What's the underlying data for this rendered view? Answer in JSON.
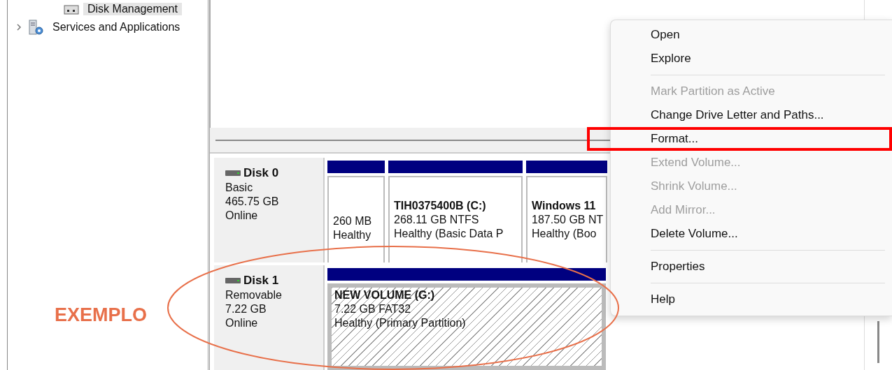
{
  "tree": [
    {
      "label": "Disk Management",
      "selected": true
    },
    {
      "label": "Services and Applications",
      "selected": false,
      "expanded": false
    }
  ],
  "disks": [
    {
      "name": "Disk 0",
      "type": "Basic",
      "size": "465.75 GB",
      "status": "Online",
      "partitions": [
        {
          "detail": "260 MB",
          "status": "Healthy",
          "selected": false
        },
        {
          "title": "TIH0375400B  (C:)",
          "detail": "268.11 GB NTFS",
          "status": "Healthy (Basic Data P",
          "selected": false
        },
        {
          "title": "Windows 11",
          "detail": "187.50 GB NT",
          "status": "Healthy (Boo",
          "selected": false
        }
      ]
    },
    {
      "name": "Disk 1",
      "type": "Removable",
      "size": "7.22 GB",
      "status": "Online",
      "partitions": [
        {
          "title": "NEW VOLUME  (G:)",
          "detail": "7.22 GB FAT32",
          "status": "Healthy (Primary Partition)",
          "selected": true
        }
      ]
    }
  ],
  "context_menu": [
    {
      "kind": "item",
      "label": "Open",
      "disabled": false,
      "highlighted": false
    },
    {
      "kind": "item",
      "label": "Explore",
      "disabled": false,
      "highlighted": false
    },
    {
      "kind": "separator"
    },
    {
      "kind": "item",
      "label": "Mark Partition as Active",
      "disabled": true,
      "highlighted": false
    },
    {
      "kind": "item",
      "label": "Change Drive Letter and Paths...",
      "disabled": false,
      "highlighted": false
    },
    {
      "kind": "item",
      "label": "Format...",
      "disabled": false,
      "highlighted": true
    },
    {
      "kind": "item",
      "label": "Extend Volume...",
      "disabled": true,
      "highlighted": false
    },
    {
      "kind": "item",
      "label": "Shrink Volume...",
      "disabled": true,
      "highlighted": false
    },
    {
      "kind": "item",
      "label": "Add Mirror...",
      "disabled": true,
      "highlighted": false
    },
    {
      "kind": "item",
      "label": "Delete Volume...",
      "disabled": false,
      "highlighted": false
    },
    {
      "kind": "separator"
    },
    {
      "kind": "item",
      "label": "Properties",
      "disabled": false,
      "highlighted": false
    },
    {
      "kind": "separator"
    },
    {
      "kind": "item",
      "label": "Help",
      "disabled": false,
      "highlighted": false
    }
  ],
  "annotation": {
    "label": "EXEMPLO"
  }
}
